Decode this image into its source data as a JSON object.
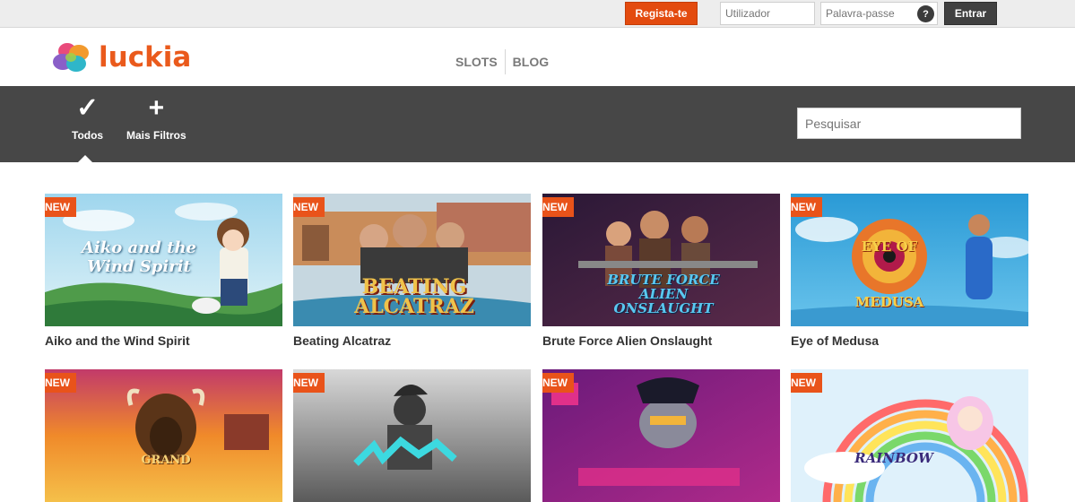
{
  "topbar": {
    "register_label": "Regista-te",
    "username_placeholder": "Utilizador",
    "password_placeholder": "Palavra-passe",
    "help_label": "?",
    "enter_label": "Entrar"
  },
  "header": {
    "logo_text": "luckia",
    "nav": [
      {
        "label": "SLOTS"
      },
      {
        "label": "BLOG"
      }
    ]
  },
  "filters": {
    "all_label": "Todos",
    "all_icon": "check-icon",
    "more_label": "Mais Filtros",
    "more_icon": "plus-icon",
    "search_placeholder": "Pesquisar"
  },
  "games": [
    {
      "title": "Aiko and the Wind Spirit",
      "badge": "NEW",
      "art": "Aiko and the Wind Spirit"
    },
    {
      "title": "Beating Alcatraz",
      "badge": "NEW",
      "art": "BEATING ALCATRAZ"
    },
    {
      "title": "Brute Force Alien Onslaught",
      "badge": "NEW",
      "art": "BRUTE FORCE ALIEN ONSLAUGHT"
    },
    {
      "title": "Eye of Medusa",
      "badge": "NEW",
      "art": "EYE OF MEDUSA"
    },
    {
      "title": "",
      "badge": "NEW",
      "art": "GRAND"
    },
    {
      "title": "",
      "badge": "NEW",
      "art": ""
    },
    {
      "title": "",
      "badge": "NEW",
      "art": ""
    },
    {
      "title": "",
      "badge": "NEW",
      "art": "RAINBOW"
    }
  ],
  "colors": {
    "brand_orange": "#e9531a",
    "filter_bar": "#474747",
    "enter_button": "#404040"
  }
}
